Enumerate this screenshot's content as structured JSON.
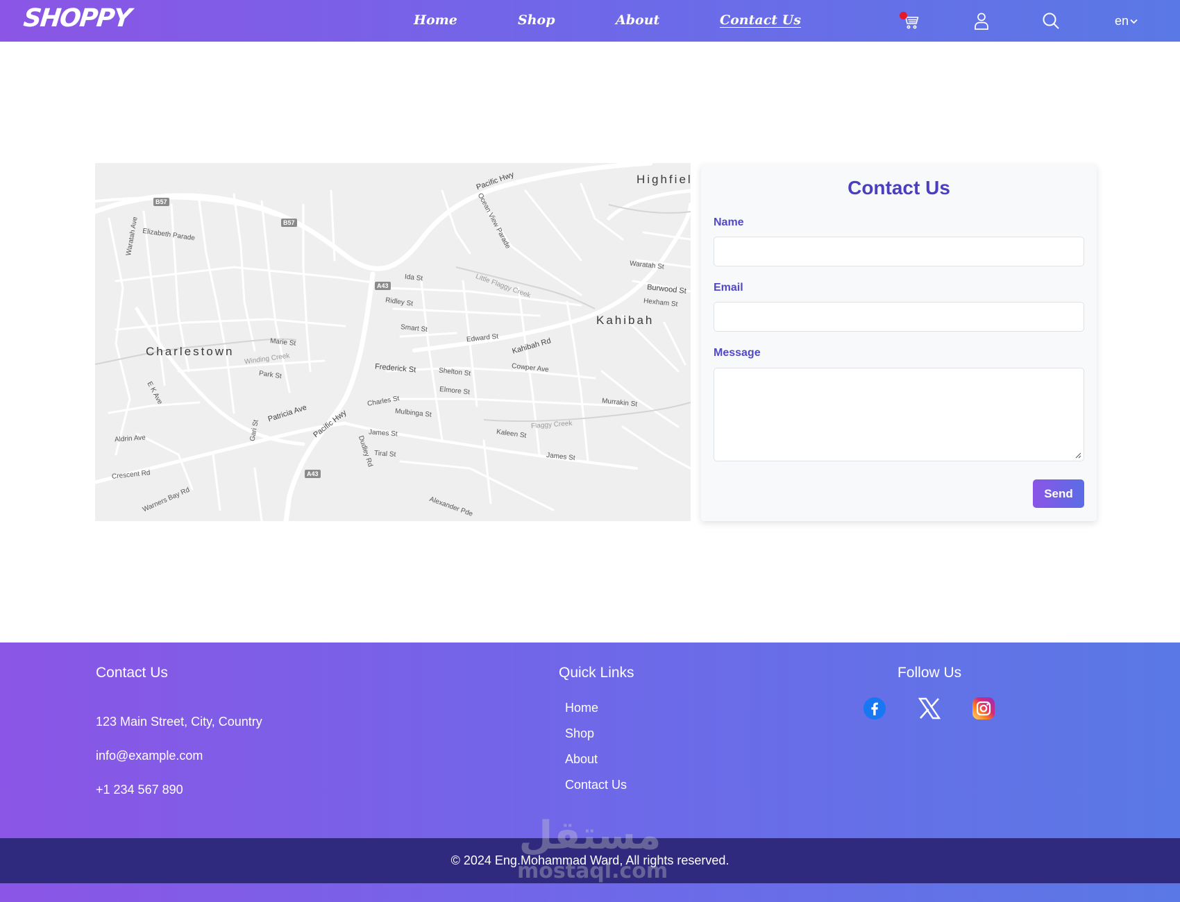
{
  "header": {
    "logo": "SHOPPY",
    "nav": {
      "home": "Home",
      "shop": "Shop",
      "about": "About",
      "contact": "Contact Us"
    },
    "language": "en",
    "icons": [
      "cart-icon",
      "user-icon",
      "search-icon",
      "chevron-down-icon"
    ],
    "colors": {
      "gradient_start": "#8b55e6",
      "gradient_end": "#5a78e6",
      "cart_badge": "#e6192b"
    }
  },
  "map": {
    "towns": {
      "charlestown": "Charlestown",
      "kahibah": "Kahibah",
      "highfield": "Highfiel"
    },
    "roads": {
      "pacific_hwy_1": "Pacific Hwy",
      "pacific_hwy_2": "Pacific Hwy",
      "frederick": "Frederick St",
      "kahibah_rd": "Kahibah Rd",
      "burwood": "Burwood St",
      "patricia": "Patricia Ave",
      "dudley": "Dudley Rd",
      "waratah": "Waratah Ave",
      "elizabeth": "Elizabeth Parade",
      "ridley": "Ridley St",
      "smart": "Smart St",
      "edward": "Edward St",
      "marie": "Marie St",
      "james": "James St",
      "james2": "James St",
      "kaleen": "Kaleen St",
      "murrakin": "Murrakin St",
      "winding": "Winding Creek",
      "little_flaggy": "Little Flaggy Creek",
      "flaggy": "Flaggy Creek",
      "shelton": "Shelton St",
      "elmore": "Elmore St",
      "mulbinga": "Mulbinga St",
      "cowper": "Cowper Ave",
      "warners": "Warners Bay Rd",
      "crescent": "Crescent Rd",
      "tiral": "Tiral St",
      "alexander": "Alexander Pde",
      "ida": "Ida St",
      "hexham": "Hexham St",
      "waratah_st": "Waratah St",
      "park": "Park St",
      "ek": "E K Ave",
      "gari": "Gari St",
      "aldrin": "Aldrin Ave",
      "charles": "Charles St",
      "ocean_view": "Ocean View Parade"
    },
    "shields": {
      "b57a": "B57",
      "b57b": "B57",
      "a43a": "A43",
      "a43b": "A43"
    }
  },
  "contact_form": {
    "title": "Contact Us",
    "name_label": "Name",
    "email_label": "Email",
    "message_label": "Message",
    "name_value": "",
    "email_value": "",
    "message_value": "",
    "send_label": "Send"
  },
  "footer": {
    "contact": {
      "heading": "Contact Us",
      "address": "123 Main Street, City, Country",
      "email": "info@example.com",
      "phone": "+1 234 567 890"
    },
    "quick_links": {
      "heading": "Quick Links",
      "items": [
        "Home",
        "Shop",
        "About",
        "Contact Us"
      ]
    },
    "follow": {
      "heading": "Follow Us",
      "icons": [
        "facebook-icon",
        "x-icon",
        "instagram-icon"
      ]
    },
    "copyright": "© 2024 Eng.Mohammad Ward, All rights reserved."
  },
  "watermark": {
    "arabic": "مستقل",
    "latin": "mostaql.com"
  }
}
